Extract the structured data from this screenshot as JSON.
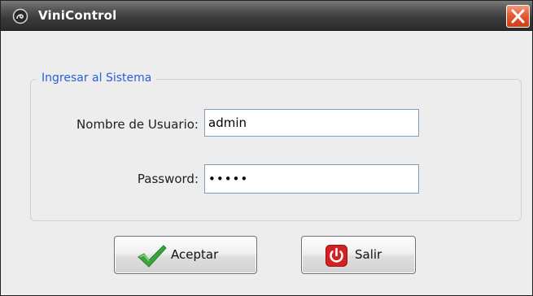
{
  "window": {
    "title": "ViniControl",
    "close_icon": "close-x-icon"
  },
  "login_group": {
    "legend": "Ingresar al Sistema",
    "username_label": "Nombre de Usuario:",
    "username_value": "admin",
    "password_label": "Password:",
    "password_value": "12345"
  },
  "buttons": {
    "accept_label": "Aceptar",
    "accept_icon": "green-checkmark-icon",
    "exit_label": "Salir",
    "exit_icon": "red-power-icon"
  },
  "colors": {
    "legend_text": "#2a5fd8",
    "close_button": "#e55b34",
    "checkmark": "#3aa53a",
    "power_icon": "#d42020"
  }
}
